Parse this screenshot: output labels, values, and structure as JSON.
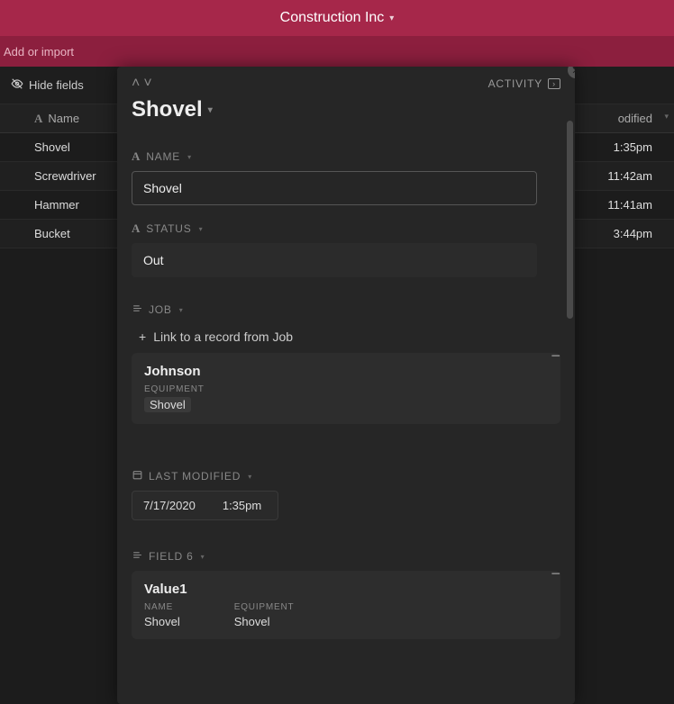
{
  "header": {
    "base_name": "Construction Inc"
  },
  "subheader": {
    "add_import": "Add or import"
  },
  "toolbar": {
    "hide_fields": "Hide fields"
  },
  "table": {
    "columns": {
      "name": "Name",
      "last_modified": "odified"
    },
    "rows": [
      {
        "name": "Shovel",
        "time": "1:35pm"
      },
      {
        "name": "Screwdriver",
        "time": "11:42am"
      },
      {
        "name": "Hammer",
        "time": "11:41am"
      },
      {
        "name": "Bucket",
        "time": "3:44pm"
      }
    ]
  },
  "record": {
    "activity_label": "ACTIVITY",
    "title": "Shovel",
    "fields": {
      "name": {
        "label": "NAME",
        "value": "Shovel"
      },
      "status": {
        "label": "STATUS",
        "value": "Out"
      },
      "job": {
        "label": "JOB",
        "link_text": "Link to a record from Job",
        "linked": {
          "title": "Johnson",
          "equipment_label": "EQUIPMENT",
          "equipment_value": "Shovel"
        }
      },
      "last_modified": {
        "label": "LAST MODIFIED",
        "date": "7/17/2020",
        "time": "1:35pm"
      },
      "field6": {
        "label": "FIELD 6",
        "linked": {
          "title": "Value1",
          "name_label": "NAME",
          "name_value": "Shovel",
          "equipment_label": "EQUIPMENT",
          "equipment_value": "Shovel"
        }
      }
    }
  }
}
